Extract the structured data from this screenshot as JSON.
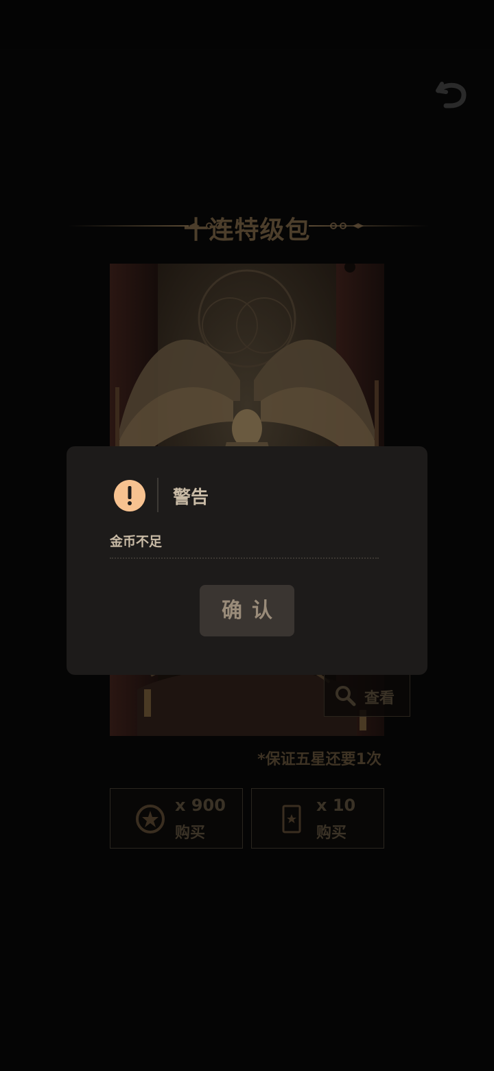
{
  "header": {
    "back_icon": "undo-arrow-icon"
  },
  "pack": {
    "title": "十连特级包",
    "view_label": "查看",
    "guarantee_text": "*保证五星还要1次"
  },
  "purchase": {
    "coin_option": {
      "icon": "star-coin-icon",
      "amount": "x 900",
      "label": "购买"
    },
    "ticket_option": {
      "icon": "star-ticket-icon",
      "amount": "x 10",
      "label": "购买"
    }
  },
  "dialog": {
    "icon": "warning-exclamation-icon",
    "title": "警告",
    "message": "金币不足",
    "confirm_label": "确认"
  },
  "colors": {
    "accent_gold": "#c9bba6",
    "warning_orange": "#f7c290",
    "dialog_bg": "#1d1b1a",
    "button_bg": "#3a3531"
  }
}
